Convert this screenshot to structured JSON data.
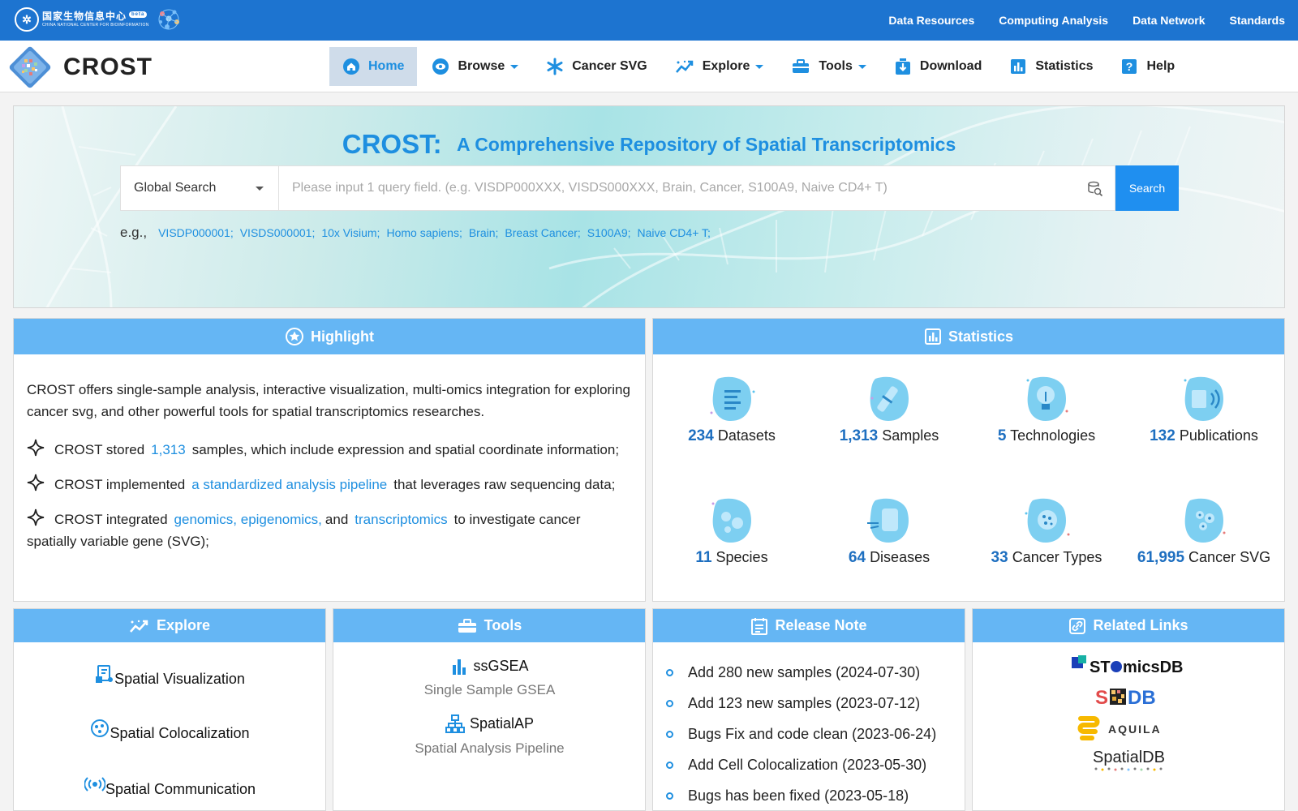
{
  "topbar": {
    "logo_cn": "国家生物信息中心",
    "logo_en": "CHINA NATIONAL CENTER FOR BIOINFORMATION",
    "logo_badge": "beta",
    "links": [
      "Data Resources",
      "Computing Analysis",
      "Data Network",
      "Standards"
    ]
  },
  "brand": {
    "name": "CROST"
  },
  "menu": [
    {
      "label": "Home",
      "icon": "home-icon",
      "active": true,
      "dropdown": false
    },
    {
      "label": "Browse",
      "icon": "eye-icon",
      "active": false,
      "dropdown": true
    },
    {
      "label": "Cancer SVG",
      "icon": "asterisk-icon",
      "active": false,
      "dropdown": false
    },
    {
      "label": "Explore",
      "icon": "trend-icon",
      "active": false,
      "dropdown": true
    },
    {
      "label": "Tools",
      "icon": "toolbox-icon",
      "active": false,
      "dropdown": true
    },
    {
      "label": "Download",
      "icon": "download-icon",
      "active": false,
      "dropdown": false
    },
    {
      "label": "Statistics",
      "icon": "bar-chart-icon",
      "active": false,
      "dropdown": false
    },
    {
      "label": "Help",
      "icon": "help-icon",
      "active": false,
      "dropdown": false
    }
  ],
  "hero": {
    "title": "CROST:",
    "subtitle": "A Comprehensive Repository of Spatial Transcriptomics",
    "search_scope": "Global Search",
    "search_placeholder": "Please input 1 query field. (e.g. VISDP000XXX, VISDS000XXX, Brain, Cancer, S100A9, Naive CD4+ T)",
    "search_button": "Search",
    "examples_label": "e.g.,",
    "examples": [
      "VISDP000001;",
      "VISDS000001;",
      "10x Visium;",
      "Homo sapiens;",
      "Brain;",
      "Breast Cancer;",
      "S100A9;",
      "Naive CD4+ T;"
    ]
  },
  "highlight": {
    "title": "Highlight",
    "intro": "CROST offers single-sample analysis, interactive visualization, multi-omics integration for exploring cancer svg, and other powerful tools for spatial transcriptomics researches.",
    "item1_pre": "CROST stored",
    "item1_link": "1,313",
    "item1_post": "samples, which include expression and spatial coordinate information;",
    "item2_pre": "CROST implemented",
    "item2_link": "a standardized analysis pipeline",
    "item2_post": "that leverages raw sequencing data;",
    "item3_pre": "CROST integrated",
    "item3_link1": "genomics, epigenomics,",
    "item3_mid": "and",
    "item3_link2": "transcriptomics",
    "item3_post": "to investigate cancer spatially variable gene (SVG);"
  },
  "statistics": {
    "title": "Statistics",
    "items": [
      {
        "num": "234",
        "label": "Datasets",
        "icon": "datasets-icon"
      },
      {
        "num": "1,313",
        "label": "Samples",
        "icon": "samples-icon"
      },
      {
        "num": "5",
        "label": "Technologies",
        "icon": "technologies-icon"
      },
      {
        "num": "132",
        "label": "Publications",
        "icon": "publications-icon"
      },
      {
        "num": "11",
        "label": "Species",
        "icon": "species-icon"
      },
      {
        "num": "64",
        "label": "Diseases",
        "icon": "diseases-icon"
      },
      {
        "num": "33",
        "label": "Cancer Types",
        "icon": "cancer-types-icon"
      },
      {
        "num": "61,995",
        "label": "Cancer SVG",
        "icon": "cancer-svg-icon"
      }
    ]
  },
  "explore": {
    "title": "Explore",
    "items": [
      "Spatial Visualization",
      "Spatial Colocalization",
      "Spatial Communication"
    ]
  },
  "tools": {
    "title": "Tools",
    "items": [
      {
        "name": "ssGSEA",
        "desc": "Single Sample GSEA"
      },
      {
        "name": "SpatialAP",
        "desc": "Spatial Analysis Pipeline"
      }
    ]
  },
  "release": {
    "title": "Release Note",
    "items": [
      "Add 280 new samples (2024-07-30)",
      "Add 123 new samples (2023-07-12)",
      "Bugs Fix and code clean (2023-06-24)",
      "Add Cell Colocalization (2023-05-30)",
      "Bugs has been fixed (2023-05-18)"
    ]
  },
  "links": {
    "title": "Related Links",
    "items": [
      {
        "name": "STOmicsDB",
        "parts": [
          "ST",
          "micsDB"
        ]
      },
      {
        "name": "SODB",
        "parts": [
          "S",
          "DB"
        ]
      },
      {
        "name": "AQUILA",
        "parts": [
          "AQUILA"
        ]
      },
      {
        "name": "SpatialDB",
        "parts": [
          "SpatialDB"
        ]
      }
    ]
  },
  "colors": {
    "primary": "#1d74d0",
    "accent": "#1e8fe0",
    "panel_header": "#65b6f4",
    "number": "#1e6fc0"
  }
}
